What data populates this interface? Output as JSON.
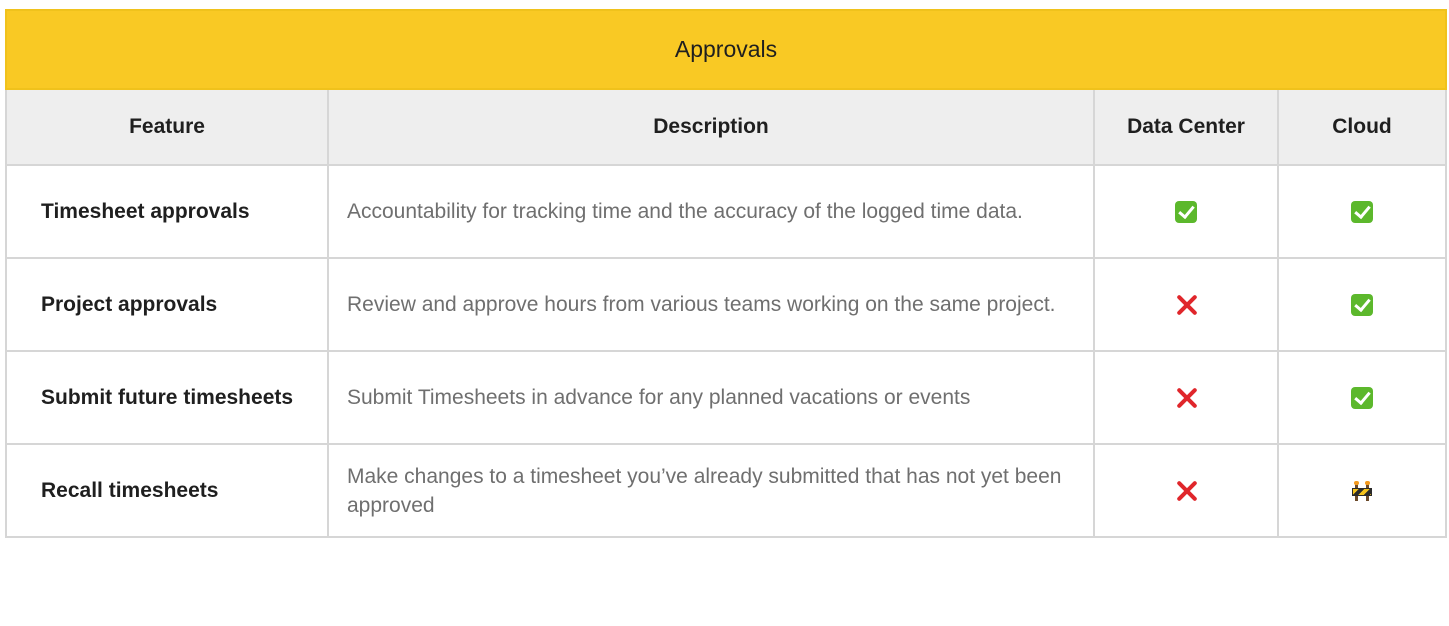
{
  "table": {
    "title": "Approvals",
    "columns": [
      "Feature",
      "Description",
      "Data Center",
      "Cloud"
    ],
    "rows": [
      {
        "feature": "Timesheet approvals",
        "description": "Accountability for tracking time and the accuracy of the logged time data.",
        "data_center": "check-icon",
        "cloud": "check-icon"
      },
      {
        "feature": "Project approvals",
        "description": "Review and approve hours from various teams working on the same project.",
        "data_center": "cross-icon",
        "cloud": "check-icon"
      },
      {
        "feature": "Submit future timesheets",
        "description": "Submit Timesheets in advance for any planned vacations or events",
        "data_center": "cross-icon",
        "cloud": "check-icon"
      },
      {
        "feature": "Recall timesheets",
        "description": "Make changes to a timesheet you’ve already submitted that has not yet been approved",
        "data_center": "cross-icon",
        "cloud": "construction-barrier-icon"
      }
    ]
  },
  "colors": {
    "title_background": "#f9c924",
    "header_background": "#eeeeee",
    "grid": "#d6d6d6",
    "check": "#5cb82c",
    "cross": "#e0262b",
    "description_text": "#6f6f6f"
  }
}
